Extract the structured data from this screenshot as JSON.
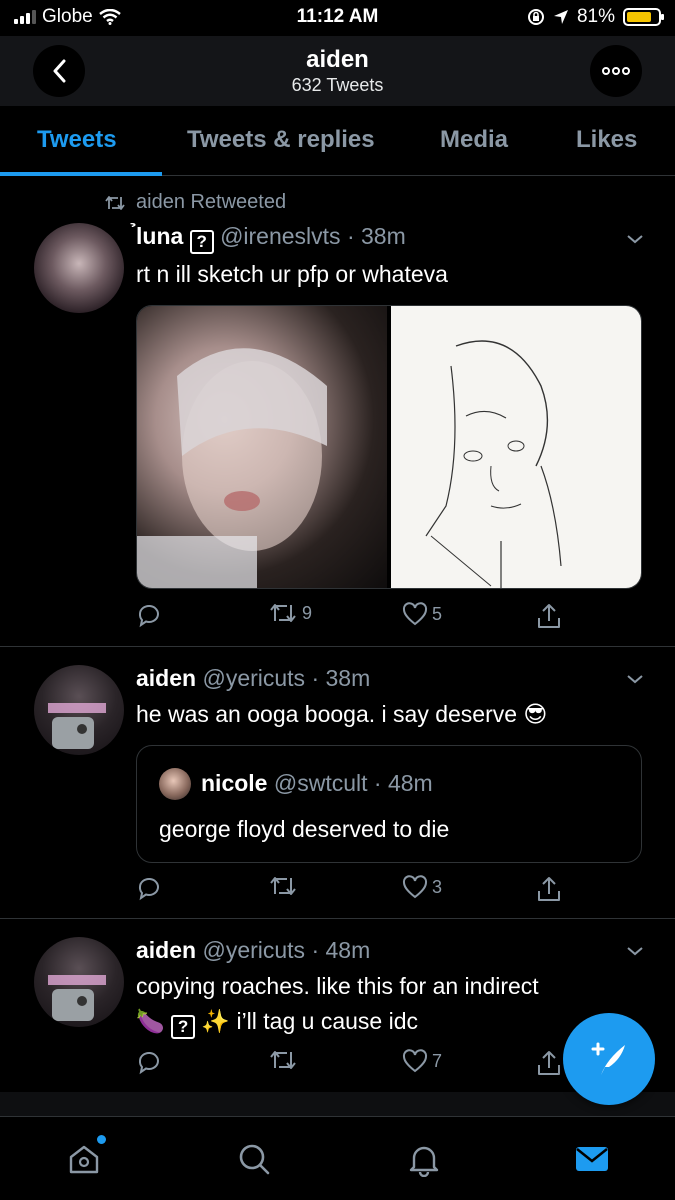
{
  "status_bar": {
    "carrier": "Globe",
    "time": "11:12 AM",
    "battery": "81%",
    "battery_level": 0.81
  },
  "header": {
    "title": "aiden",
    "subtitle": "632 Tweets"
  },
  "tabs": [
    {
      "label": "Tweets",
      "active": true
    },
    {
      "label": "Tweets & replies",
      "active": false
    },
    {
      "label": "Media",
      "active": false
    },
    {
      "label": "Likes",
      "active": false
    }
  ],
  "tweets": [
    {
      "retweet_banner": "aiden Retweeted",
      "name": "̉luna",
      "handle": "@ireneslvts",
      "time": "38m",
      "text": "rt n ill sketch ur pfp or whateva",
      "retweets": "9",
      "likes": "5"
    },
    {
      "name": "aiden",
      "handle": "@yericuts",
      "time": "38m",
      "text": "he was an ooga booga. i say deserve 😎",
      "quote": {
        "name": "nicole",
        "handle": "@swtcult",
        "time": "48m",
        "text": "george floyd deserved to die"
      },
      "retweets": "",
      "likes": "3"
    },
    {
      "name": "aiden",
      "handle": "@yericuts",
      "time": "48m",
      "text_line1": "copying roaches. like this for an indirect",
      "text_line2": "i’ll tag u cause idc",
      "retweets": "",
      "likes": "7"
    }
  ],
  "colors": {
    "accent": "#1d9bf0",
    "muted": "#8b98a5",
    "border": "#2f3336",
    "header_bg": "#141518"
  },
  "icons": [
    "back-icon",
    "more-icon",
    "retweet-icon",
    "reply-icon",
    "like-icon",
    "share-icon",
    "caret-down-icon",
    "compose-icon",
    "home-icon",
    "search-icon",
    "notifications-icon",
    "messages-icon"
  ]
}
